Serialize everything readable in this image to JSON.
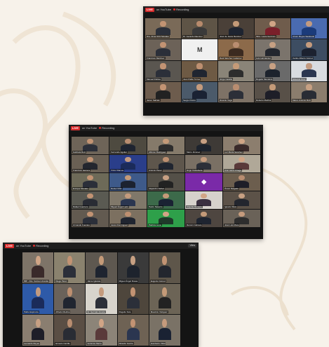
{
  "windows": [
    {
      "id": "w1",
      "live_badge": "LIVE",
      "platform": "on YouTube",
      "recording": "Recording",
      "cols": 5,
      "participants": [
        {
          "name": "Dra. Alma Ortiz Morales",
          "bg": "#7a6a58",
          "skin": "#c29373",
          "shirt": "#2b2f39"
        },
        {
          "name": "Dr. Gerardo Ramírez",
          "bg": "#5e5446",
          "skin": "#b78a6c",
          "shirt": "#3a3a3a"
        },
        {
          "name": "José de Jesús Ramírez",
          "bg": "#4a4038",
          "skin": "#c49a78",
          "shirt": "#1e2430"
        },
        {
          "name": "Mtra. Laura Guzmán",
          "bg": "#6f5c4c",
          "skin": "#d1a586",
          "shirt": "#7a1f2a"
        },
        {
          "name": "Arturo Reyes Sandoval",
          "bg": "#4a6bb0",
          "skin": "#c29a80",
          "shirt": "#1b3b7a"
        },
        {
          "name": "Francisco Martínez",
          "bg": "#6c6258",
          "skin": "#c29373",
          "shirt": "#2b2f39"
        },
        {
          "name": "",
          "bg": "#f0f0f0",
          "skin": "#c29373",
          "shirt": "#2b2f39",
          "logo": "M",
          "logo_color": "#3a3a3a"
        },
        {
          "name": "Raúl Sánchez Gutiérrez",
          "bg": "#8c6a4a",
          "skin": "#b98d70",
          "shirt": "#3b2a20"
        },
        {
          "name": "Luis Hernández",
          "bg": "#7b746c",
          "skin": "#c7a083",
          "shirt": "#23262e"
        },
        {
          "name": "Carlos Alberto Gómez",
          "bg": "#3d4d62",
          "skin": "#c59b7d",
          "shirt": "#1c2230"
        },
        {
          "name": "Manuel Robles",
          "bg": "#5a5650",
          "skin": "#c29373",
          "shirt": "#2b2f39"
        },
        {
          "name": "Juan Pablo Torres",
          "bg": "#6e5a44",
          "skin": "#bd8f70",
          "shirt": "#202530"
        },
        {
          "name": "Jorge Castillo",
          "bg": "#8a8478",
          "skin": "#c49a78",
          "shirt": "#2d2d2d"
        },
        {
          "name": "Rogelio Mendoza",
          "bg": "#6a6a6a",
          "skin": "#c7a083",
          "shirt": "#1d232d"
        },
        {
          "name": "Eduardo Cruz",
          "bg": "#d9dce0",
          "skin": "#c29a80",
          "shirt": "#2b3650"
        },
        {
          "name": "Javier Salinas",
          "bg": "#6d5c4d",
          "skin": "#c29373",
          "shirt": "#222"
        },
        {
          "name": "Sergio Flores",
          "bg": "#4b5a6a",
          "skin": "#c59b7d",
          "shirt": "#1a2233"
        },
        {
          "name": "Ricardo Vega",
          "bg": "#7e7266",
          "skin": "#b98d70",
          "shirt": "#2c2f38"
        },
        {
          "name": "Roberto Medina",
          "bg": "#585048",
          "skin": "#c49a78",
          "shirt": "#1e1e28"
        },
        {
          "name": "Marco Antonio Ruiz",
          "bg": "#8b7d6d",
          "skin": "#c7a083",
          "shirt": "#292c34"
        }
      ]
    },
    {
      "id": "w2",
      "live_badge": "LIVE",
      "platform": "on YouTube",
      "recording": "Recording",
      "cols": 5,
      "participants": [
        {
          "name": "Gabriela Ruiz",
          "bg": "#6e6458",
          "skin": "#c29373",
          "shirt": "#2b2f39"
        },
        {
          "name": "Fernando Aguilar",
          "bg": "#4e4a40",
          "skin": "#b98d70",
          "shirt": "#1e2430"
        },
        {
          "name": "Alfonso Rodríguez",
          "bg": "#857a6a",
          "skin": "#c49a78",
          "shirt": "#2d2d2d"
        },
        {
          "name": "Mario Jiménez",
          "bg": "#3e3a36",
          "skin": "#c7a083",
          "shirt": "#1d232d"
        },
        {
          "name": "Luz María Sánchez",
          "bg": "#8c7e6e",
          "skin": "#d1a586",
          "shirt": "#3a2a2a"
        },
        {
          "name": "Francisco Herrera",
          "bg": "#6a6054",
          "skin": "#c29373",
          "shirt": "#23262e"
        },
        {
          "name": "Víctor Ramos",
          "bg": "#2a3e8a",
          "skin": "#c29a80",
          "shirt": "#1b2b5a"
        },
        {
          "name": "Antonio Pérez",
          "bg": "#5e564c",
          "skin": "#bd8f70",
          "shirt": "#202530"
        },
        {
          "name": "Hugo Castañeda",
          "bg": "#7a7064",
          "skin": "#c59b7d",
          "shirt": "#2c2f38"
        },
        {
          "name": "Ana Laura Ortega",
          "bg": "#b0a898",
          "skin": "#d1a586",
          "shirt": "#5a3a3a"
        },
        {
          "name": "Enrique Morales",
          "bg": "#6d6a58",
          "skin": "#c29373",
          "shirt": "#2b2f39"
        },
        {
          "name": "Daniel Ortiz",
          "bg": "#3e5a8a",
          "skin": "#c49a78",
          "shirt": "#1c2230"
        },
        {
          "name": "Alejandro Núñez",
          "bg": "#545048",
          "skin": "#c7a083",
          "shirt": "#222"
        },
        {
          "name": "",
          "bg": "#7a2aa8",
          "skin": "#c29373",
          "shirt": "#2b2f39",
          "logo": "◆",
          "logo_color": "#ffffff"
        },
        {
          "name": "Óscar Delgado",
          "bg": "#6c5e4e",
          "skin": "#b98d70",
          "shirt": "#1e1e28"
        },
        {
          "name": "Rafael Guerrero",
          "bg": "#5a5a52",
          "skin": "#c29373",
          "shirt": "#292c34"
        },
        {
          "name": "Miguel Ángel León",
          "bg": "#80786a",
          "skin": "#c59b7d",
          "shirt": "#2b3650"
        },
        {
          "name": "Pedro Navarro",
          "bg": "#3c6a4a",
          "skin": "#c49a78",
          "shirt": "#1a2233"
        },
        {
          "name": "Claudia Romero",
          "bg": "#d6d2cc",
          "skin": "#d1a586",
          "shirt": "#3a3040"
        },
        {
          "name": "Ignacio Silva",
          "bg": "#5c5248",
          "skin": "#c7a083",
          "shirt": "#23262e"
        },
        {
          "name": "Armando Fuentes",
          "bg": "#625a50",
          "skin": "#c29373",
          "shirt": "#2b2f39"
        },
        {
          "name": "Jesús Domínguez",
          "bg": "#7c7060",
          "skin": "#bd8f70",
          "shirt": "#202530"
        },
        {
          "name": "Patricia Luna",
          "bg": "#2ea04a",
          "skin": "#d1a586",
          "shirt": "#1f3a2a"
        },
        {
          "name": "Ramón Cabrera",
          "bg": "#4e4640",
          "skin": "#c49a78",
          "shirt": "#1e2430"
        },
        {
          "name": "José Luis Mora",
          "bg": "#6a6258",
          "skin": "#c59b7d",
          "shirt": "#2d2d2d"
        }
      ]
    },
    {
      "id": "w3",
      "live_badge": "LIVE",
      "platform": "on YouTube",
      "recording": "Recording",
      "view": "View",
      "cols": 5,
      "participants": [
        {
          "name": "IBP - Dra. Carmen Aranda",
          "bg": "#7e7468",
          "skin": "#d1a586",
          "shirt": "#3a2a2a"
        },
        {
          "name": "Diego Pérez",
          "bg": "#8a826e",
          "skin": "#c29373",
          "shirt": "#2b2f39"
        },
        {
          "name": "Jaime Iglesias",
          "bg": "#5e5850",
          "skin": "#c49a78",
          "shirt": "#1e2430"
        },
        {
          "name": "Miguel Ángel Rosas",
          "bg": "#3a3a3a",
          "skin": "#c7a083",
          "shirt": "#1d232d"
        },
        {
          "name": "Eugenio Gómez",
          "bg": "#5e564a",
          "skin": "#c29373",
          "shirt": "#23262e"
        },
        {
          "name": "Pablo Espinoza",
          "bg": "#2e5aa8",
          "skin": "#c29a80",
          "shirt": "#1b2b5a"
        },
        {
          "name": "Alfredo Medina",
          "bg": "#6a625a",
          "skin": "#bd8f70",
          "shirt": "#202530"
        },
        {
          "name": "Dr. Germán Acosta",
          "bg": "#d8d4cc",
          "skin": "#c59b7d",
          "shirt": "#2c2f38"
        },
        {
          "name": "Rogelio Soto",
          "bg": "#4e463c",
          "skin": "#c29373",
          "shirt": "#2b2f39"
        },
        {
          "name": "Mauricio Vázquez",
          "bg": "#6c6456",
          "skin": "#c49a78",
          "shirt": "#222"
        },
        {
          "name": "Leonardo Reyes",
          "bg": "#8a7e70",
          "skin": "#c7a083",
          "shirt": "#1e1e28"
        },
        {
          "name": "Ernesto Carrillo",
          "bg": "#5a4e44",
          "skin": "#b98d70",
          "shirt": "#292c34"
        },
        {
          "name": "Verónica Ibarra",
          "bg": "#8c8478",
          "skin": "#d1a586",
          "shirt": "#5a3a3a"
        },
        {
          "name": "Ricardo García",
          "bg": "#6e6254",
          "skin": "#c29373",
          "shirt": "#2b3650"
        },
        {
          "name": "Humberto Vidal",
          "bg": "#7a7266",
          "skin": "#c59b7d",
          "shirt": "#1a2233"
        }
      ]
    }
  ]
}
